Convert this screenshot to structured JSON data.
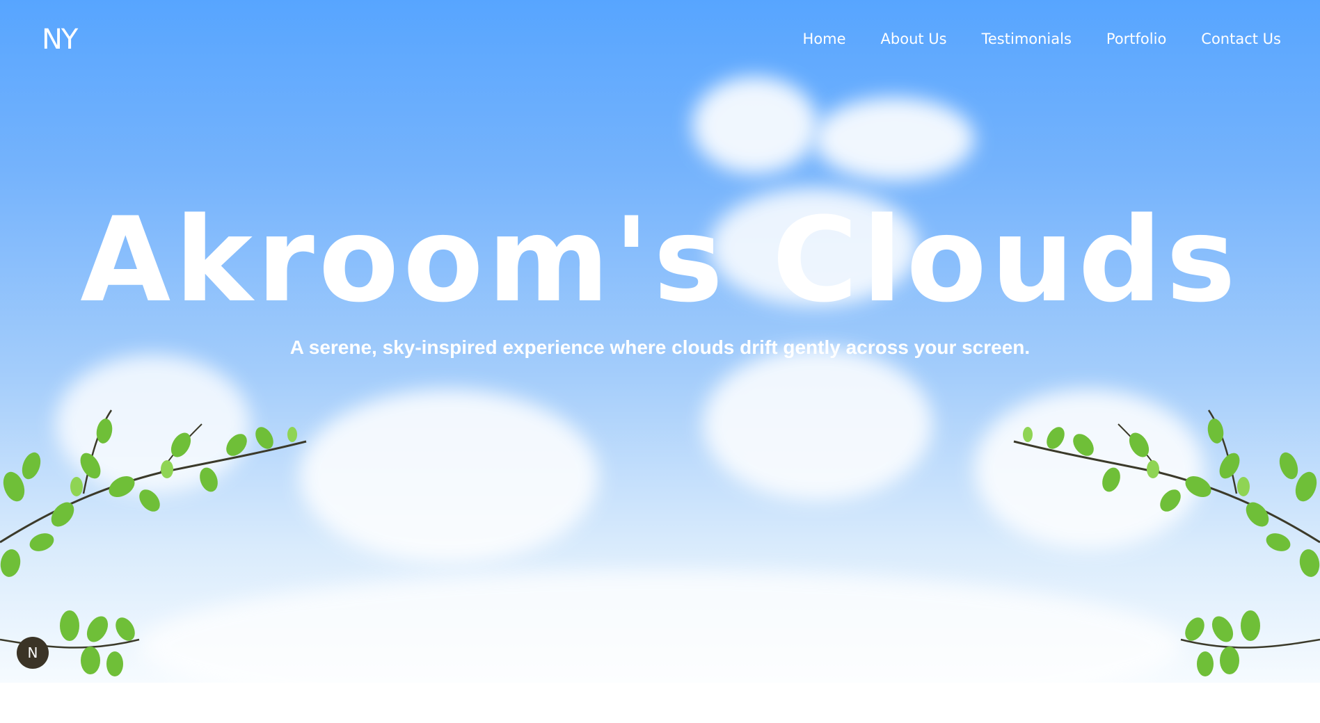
{
  "logo": {
    "text": "NY"
  },
  "nav": {
    "items": [
      {
        "label": "Home"
      },
      {
        "label": "About Us"
      },
      {
        "label": "Testimonials"
      },
      {
        "label": "Portfolio"
      },
      {
        "label": "Contact Us"
      }
    ]
  },
  "hero": {
    "title": "Akroom's Clouds",
    "subtitle": "A serene, sky-inspired experience where clouds drift gently across your screen."
  },
  "badge": {
    "text": "N"
  },
  "colors": {
    "sky_top": "#57a5ff",
    "sky_bottom": "#f6fbff",
    "text": "#ffffff",
    "leaf": "#72c13b",
    "badge": "#3b3426"
  },
  "icons": [
    "branch-leaves-icon",
    "next-logo-icon"
  ]
}
